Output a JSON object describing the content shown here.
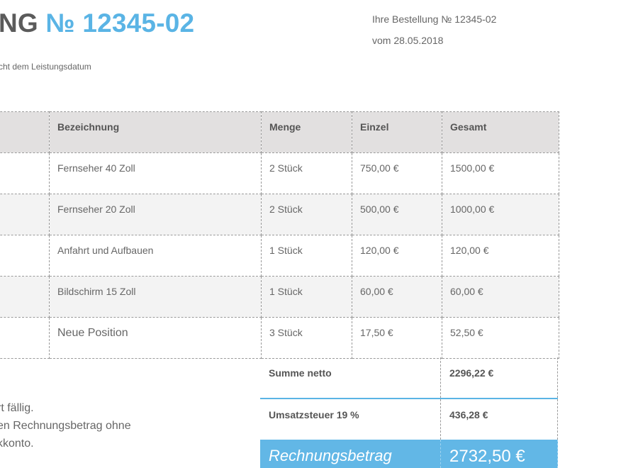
{
  "header": {
    "title_prefix": "NG",
    "title_number": "№ 12345-02",
    "note": "cht dem Leistungsdatum",
    "order_line": "Ihre Bestellung № 12345-02",
    "order_date": "vom 28.05.2018"
  },
  "table": {
    "columns": [
      "",
      "Bezeichnung",
      "Menge",
      "Einzel",
      "Gesamt"
    ],
    "rows": [
      {
        "name": "Fernseher 40 Zoll",
        "qty": "2 Stück",
        "unit": "750,00 €",
        "total": "1500,00 €"
      },
      {
        "name": "Fernseher 20 Zoll",
        "qty": "2 Stück",
        "unit": "500,00 €",
        "total": "1000,00 €"
      },
      {
        "name": "Anfahrt und Aufbauen",
        "qty": "1 Stück",
        "unit": "120,00 €",
        "total": "120,00 €"
      },
      {
        "name": "Bildschirm 15 Zoll",
        "qty": "1 Stück",
        "unit": "60,00 €",
        "total": "60,00 €"
      },
      {
        "name": "Neue Position",
        "qty": "3 Stück",
        "unit": "17,50 €",
        "total": "52,50 €"
      }
    ]
  },
  "totals": {
    "net_label": "Summe netto",
    "net_value": "2296,22 €",
    "vat_label": "Umsatzsteuer 19 %",
    "vat_value": "436,28 €",
    "grand_label": "Rechnungsbetrag",
    "grand_value": "2732,50 €"
  },
  "payment": {
    "line1": "rt fällig.",
    "line2": "en Rechnungsbetrag ohne",
    "line3": "kkonto."
  },
  "colors": {
    "accent": "#5ab4e5",
    "header_bg": "#e2e0e0",
    "grand_bg": "#62b7e6"
  }
}
